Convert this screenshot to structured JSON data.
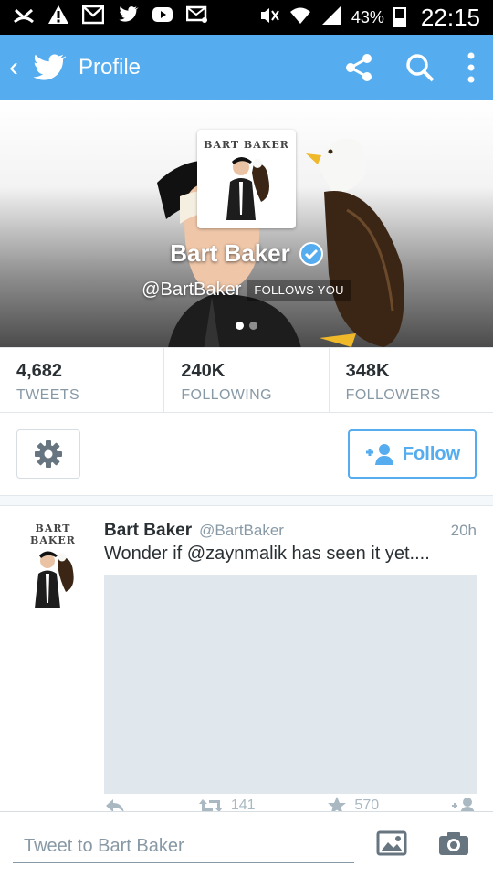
{
  "status_bar": {
    "battery": "43%",
    "time": "22:15"
  },
  "app_bar": {
    "back": "‹",
    "title": "Profile"
  },
  "profile": {
    "avatar_logo_text": "BART BAKER",
    "name": "Bart Baker",
    "handle": "@BartBaker",
    "follows_you": "FOLLOWS YOU"
  },
  "stats": [
    {
      "value": "4,682",
      "label": "TWEETS"
    },
    {
      "value": "240K",
      "label": "FOLLOWING"
    },
    {
      "value": "348K",
      "label": "FOLLOWERS"
    }
  ],
  "actions": {
    "follow_label": "Follow"
  },
  "tweet": {
    "avatar_logo_text": "BART BAKER",
    "name": "Bart Baker",
    "handle": "@BartBaker",
    "time": "20h",
    "text": "Wonder if @zaynmalik has seen it yet....",
    "retweets": "141",
    "favorites": "570"
  },
  "compose": {
    "placeholder": "Tweet to Bart Baker"
  },
  "colors": {
    "brand": "#55acee",
    "media_placeholder": "#e1e8ed"
  }
}
